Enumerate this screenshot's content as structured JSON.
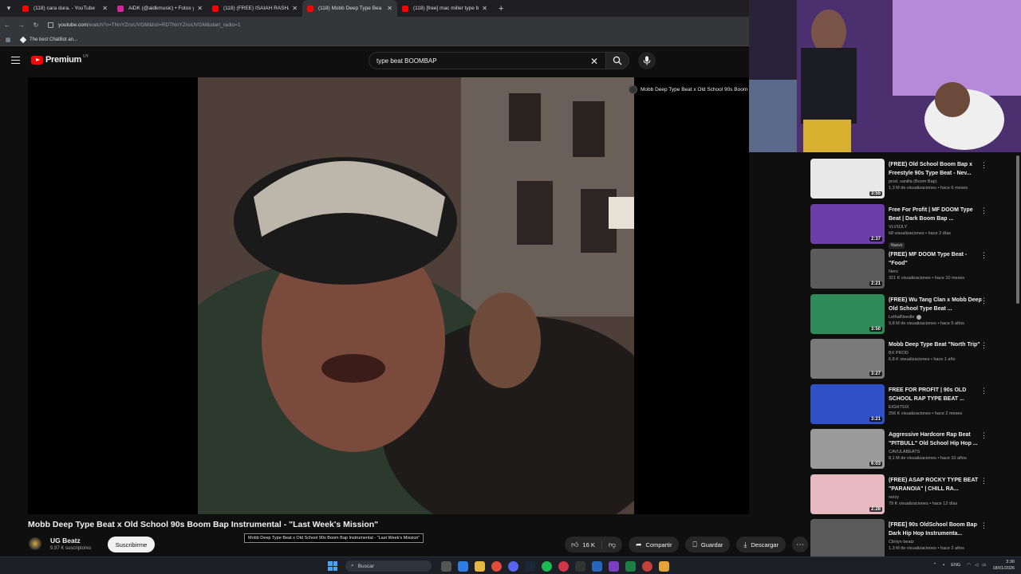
{
  "browser": {
    "tabs": [
      {
        "title": "(118) cara dura. - YouTube",
        "favicon_color": "#ff0000",
        "active": false
      },
      {
        "title": "AiDK (@aidkmusic) • Fotos y vi",
        "favicon_color": "#d6249f",
        "active": false
      },
      {
        "title": "(118) (FREE) ISAIAH RASHAD T",
        "favicon_color": "#ff0000",
        "active": false
      },
      {
        "title": "(118) Mobb Deep Type Bea",
        "favicon_color": "#ff0000",
        "active": true
      },
      {
        "title": "(118) [free] mac miller type bea",
        "favicon_color": "#ff0000",
        "active": false
      }
    ],
    "url_host": "youtube.com",
    "url_path": "/watch?v=TNnYZnsUVGM&list=RDTNnYZnsUVGM&start_radio=1",
    "bookmark": "The best ChatBot an..."
  },
  "youtube": {
    "logo_word": "Premium",
    "country_code": "UY",
    "search_value": "type beat BOOMBAP"
  },
  "player": {
    "overlay_title": "Mobb Deep Type Beat x Old School 90s Boom Bap"
  },
  "video": {
    "title": "Mobb Deep Type Beat x Old School 90s Boom Bap Instrumental - \"Last Week's Mission\"",
    "tooltip": "Mobb Deep Type Beat x Old School 90s Boom Bap Instrumental - \"Last Week's Mission\"",
    "channel": "UG Beatz",
    "subscribers": "9,97 K suscriptores",
    "subscribe_label": "Suscribirme",
    "likes": "16 K",
    "share_label": "Compartir",
    "save_label": "Guardar",
    "download_label": "Descargar"
  },
  "recommendations": [
    {
      "title": "(FREE) Old School Boom Bap x Freestyle 90s Type Beat - Nev...",
      "channel": "prod. vanilla (Boom Bap)",
      "meta": "1,3 M de visualizaciones • hace 6 meses",
      "duration": "3:55",
      "verified": false,
      "badge": "",
      "thumb": "#e8e8e8"
    },
    {
      "title": "Free For Profit | MF DOOM Type Beat | Dark Boom Bap ...",
      "channel": "VLV1DLY",
      "meta": "68 visualizaciones • hace 2 días",
      "duration": "2:37",
      "verified": false,
      "badge": "Nuevo",
      "thumb": "#6c3fa8"
    },
    {
      "title": "(FREE) MF DOOM Type Beat - \"Food\"",
      "channel": "Nero",
      "meta": "321 K visualizaciones • hace 10 meses",
      "duration": "2:21",
      "verified": false,
      "badge": "",
      "thumb": "#5b5b5b"
    },
    {
      "title": "(FREE) Wu Tang Clan x Mobb Deep Old School Type Beat ...",
      "channel": "LethalNeedle",
      "meta": "9,8 M de visualizaciones • hace 5 años",
      "duration": "3:50",
      "verified": true,
      "badge": "",
      "thumb": "#2f8a5a"
    },
    {
      "title": "Mobb Deep Type Beat \"North Trip\"",
      "channel": "BX PROD",
      "meta": "6,8 K visualizaciones • hace 1 año",
      "duration": "3:27",
      "verified": false,
      "badge": "",
      "thumb": "#7a7a7a"
    },
    {
      "title": "FREE FOR PROFIT | 90s OLD SCHOOL RAP TYPE BEAT ...",
      "channel": "EIGHTSIX",
      "meta": "256 K visualizaciones • hace 2 meses",
      "duration": "3:21",
      "verified": false,
      "badge": "",
      "thumb": "#3050c8"
    },
    {
      "title": "Aggressive Hardcore Rap Beat \"PITBULL\" Old School Hip Hop ...",
      "channel": "CAVULABEATS",
      "meta": "8,1 M de visualizaciones • hace 10 años",
      "duration": "6:03",
      "verified": false,
      "badge": "",
      "thumb": "#9a9a9a"
    },
    {
      "title": "(FREE) ASAP ROCKY TYPE BEAT \"PARANOIA\" | CHILL RA...",
      "channel": "noizy",
      "meta": "79 K visualizaciones • hace 12 días",
      "duration": "2:28",
      "verified": false,
      "badge": "",
      "thumb": "#e8b8c0"
    },
    {
      "title": "[FREE] 90s OldSchool Boom Bap Dark Hip Hop Instrumenta...",
      "channel": "Clintyn beatz",
      "meta": "1,3 M de visualizaciones • hace 2 años",
      "duration": "",
      "verified": false,
      "badge": "",
      "thumb": "#5a5a5a"
    }
  ],
  "taskbar": {
    "search_placeholder": "Buscar",
    "language": "ENG",
    "time": "3:30",
    "date": "18/01/2026"
  }
}
